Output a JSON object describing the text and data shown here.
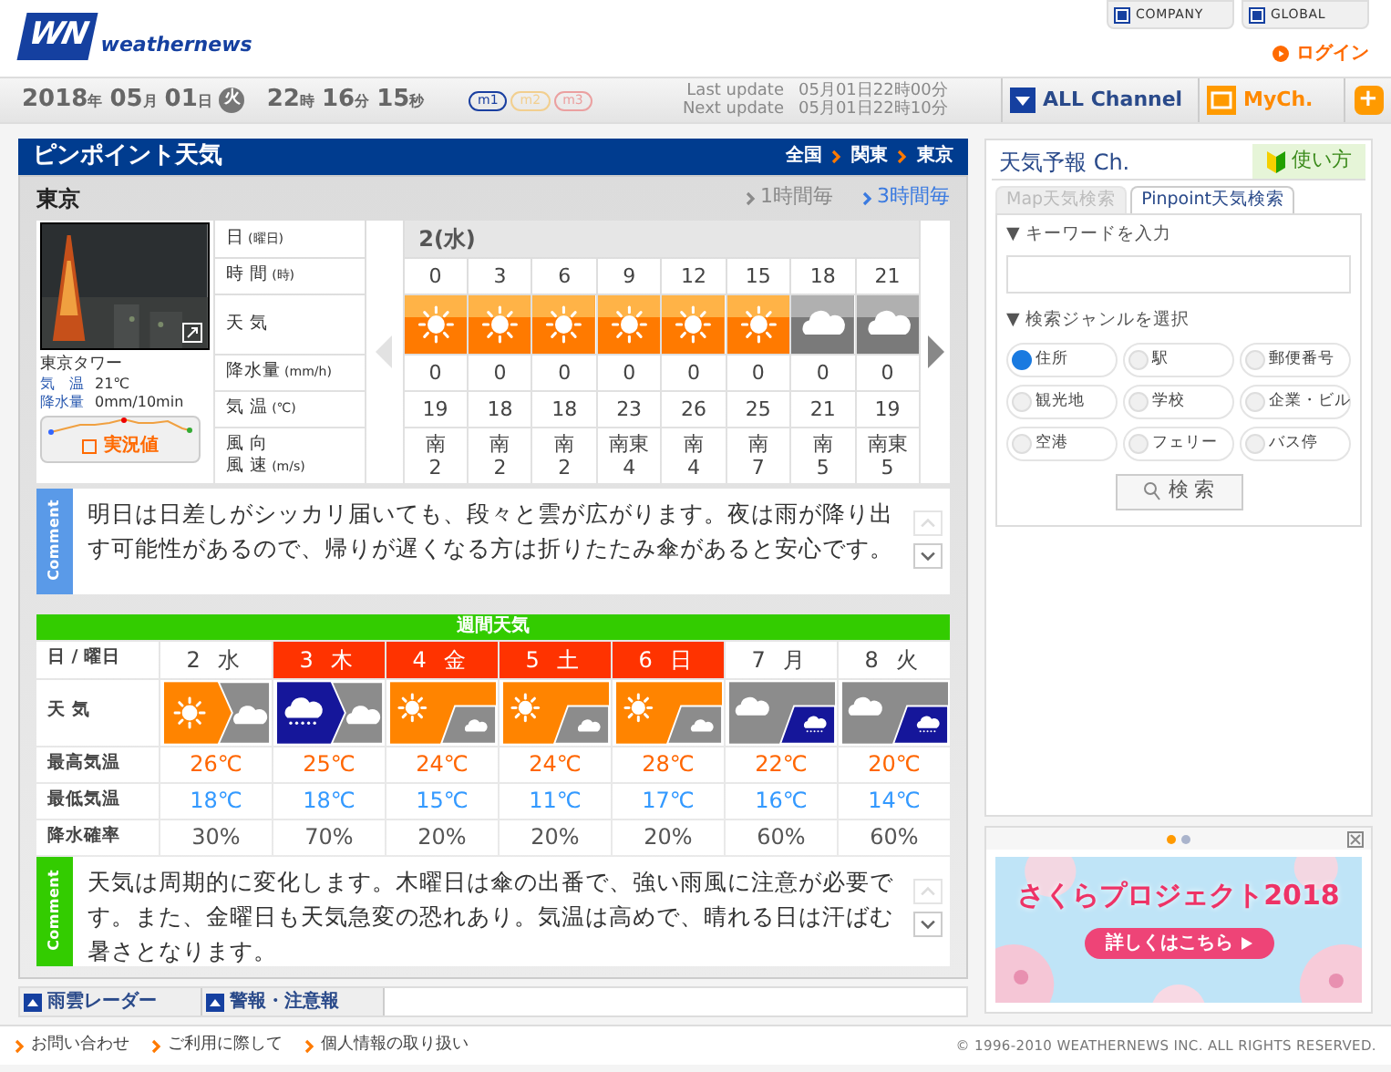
{
  "header": {
    "logo_mark": "WN",
    "logo_text": "weathernews",
    "links": [
      "COMPANY",
      "GLOBAL"
    ],
    "login": "ログイン"
  },
  "clock": {
    "date_parts": [
      {
        "value": "2018",
        "unit": "年"
      },
      {
        "value": "05",
        "unit": "月"
      },
      {
        "value": "01",
        "unit": "日"
      }
    ],
    "weekday": "火",
    "time_parts": [
      {
        "value": "22",
        "unit": "時"
      },
      {
        "value": "16",
        "unit": "分"
      },
      {
        "value": "15",
        "unit": "秒"
      }
    ]
  },
  "modes": [
    {
      "label": "m1",
      "color": "#1a3fa0"
    },
    {
      "label": "m2",
      "color": "#f2cf8f"
    },
    {
      "label": "m3",
      "color": "#eba0a0"
    }
  ],
  "updates": [
    {
      "label": "Last update",
      "value": "05月01日22時00分"
    },
    {
      "label": "Next update",
      "value": "05月01日22時10分"
    }
  ],
  "channels": [
    {
      "label": "ALL Channel",
      "kind": "all"
    },
    {
      "label": "MyCh.",
      "kind": "my"
    }
  ],
  "add_button": "+",
  "pinpoint": {
    "title": "ピンポイント天気",
    "breadcrumb": [
      "全国",
      "関東",
      "東京"
    ],
    "location": "東京",
    "intervals": [
      {
        "label": "1時間毎",
        "selected": false
      },
      {
        "label": "3時間毎",
        "selected": true
      }
    ],
    "camera": {
      "caption": "東京タワー",
      "readings": [
        {
          "label": "気　温",
          "value": "21℃"
        },
        {
          "label": "降水量",
          "value": "0mm/10min"
        }
      ],
      "button": "実況値"
    },
    "row_labels": [
      {
        "lines": [
          "日"
        ],
        "sub": "(曜日)"
      },
      {
        "lines": [
          "時 間"
        ],
        "sub": "(時)"
      },
      {
        "lines": [
          "天 気"
        ]
      },
      {
        "lines": [
          "降水量"
        ],
        "sub": "(mm/h)"
      },
      {
        "lines": [
          "気 温"
        ],
        "sub": "(℃)"
      },
      {
        "lines": [
          "風 向",
          "風 速"
        ],
        "sub": "(m/s)"
      }
    ],
    "day": "2(水)",
    "hours": [
      {
        "hour": "0",
        "kind": "sunny",
        "precip": "0",
        "temp": "19",
        "wind_dir": "南",
        "wind_speed": "2"
      },
      {
        "hour": "3",
        "kind": "sunny",
        "precip": "0",
        "temp": "18",
        "wind_dir": "南",
        "wind_speed": "2"
      },
      {
        "hour": "6",
        "kind": "sunny",
        "precip": "0",
        "temp": "18",
        "wind_dir": "南",
        "wind_speed": "2"
      },
      {
        "hour": "9",
        "kind": "sunny",
        "precip": "0",
        "temp": "23",
        "wind_dir": "南東",
        "wind_speed": "4"
      },
      {
        "hour": "12",
        "kind": "sunny",
        "precip": "0",
        "temp": "26",
        "wind_dir": "南",
        "wind_speed": "4"
      },
      {
        "hour": "15",
        "kind": "sunny",
        "precip": "0",
        "temp": "25",
        "wind_dir": "南",
        "wind_speed": "7"
      },
      {
        "hour": "18",
        "kind": "cloudy",
        "precip": "0",
        "temp": "21",
        "wind_dir": "南",
        "wind_speed": "5"
      },
      {
        "hour": "21",
        "kind": "cloudy",
        "precip": "0",
        "temp": "19",
        "wind_dir": "南東",
        "wind_speed": "5"
      }
    ],
    "comment": {
      "label": "Comment",
      "text": "明日は日差しがシッカリ届いても、段々と雲が広がります。夜は雨が降り出す可能性があるので、帰りが遅くなる方は折りたたみ傘があると安心です。"
    }
  },
  "weekly": {
    "title": "週間天気",
    "row_labels": [
      "日 / 曜日",
      "天 気",
      "最高気温",
      "最低気温",
      "降水確率"
    ],
    "days": [
      {
        "date": "2",
        "weekday": "水",
        "highlighted": false,
        "kind": "sunny_arrow_cloudy",
        "high": "26℃",
        "low": "18℃",
        "precip": "30%"
      },
      {
        "date": "3",
        "weekday": "木",
        "highlighted": true,
        "kind": "rain_arrow_cloudy",
        "high": "25℃",
        "low": "18℃",
        "precip": "70%"
      },
      {
        "date": "4",
        "weekday": "金",
        "highlighted": true,
        "kind": "sunny_split_cloudy",
        "high": "24℃",
        "low": "15℃",
        "precip": "20%"
      },
      {
        "date": "5",
        "weekday": "土",
        "highlighted": true,
        "kind": "sunny_split_cloudy",
        "high": "24℃",
        "low": "11℃",
        "precip": "20%"
      },
      {
        "date": "6",
        "weekday": "日",
        "highlighted": true,
        "kind": "sunny_split_cloudy",
        "high": "28℃",
        "low": "17℃",
        "precip": "20%"
      },
      {
        "date": "7",
        "weekday": "月",
        "highlighted": false,
        "kind": "cloudy_split_rain",
        "high": "22℃",
        "low": "16℃",
        "precip": "60%"
      },
      {
        "date": "8",
        "weekday": "火",
        "highlighted": false,
        "kind": "cloudy_split_rain",
        "high": "20℃",
        "low": "14℃",
        "precip": "60%"
      }
    ],
    "comment": {
      "label": "Comment",
      "text": "天気は周期的に変化します。木曜日は傘の出番で、強い雨風に注意が必要です。また、金曜日も天気急変の恐れあり。気温は高めで、晴れる日は汗ばむ暑さとなります。"
    }
  },
  "bottom_tabs": [
    "雨雲レーダー",
    "警報・注意報"
  ],
  "side": {
    "title": "天気予報 Ch.",
    "help": "使い方",
    "tabs": [
      {
        "label": "Map天気検索",
        "selected": false
      },
      {
        "label": "Pinpoint天気検索",
        "selected": true
      }
    ],
    "keyword_label": "▼ キーワードを入力",
    "genre_label": "▼ 検索ジャンルを選択",
    "genres": [
      {
        "label": "住所",
        "selected": true
      },
      {
        "label": "駅",
        "selected": false
      },
      {
        "label": "郵便番号",
        "selected": false
      },
      {
        "label": "観光地",
        "selected": false
      },
      {
        "label": "学校",
        "selected": false
      },
      {
        "label": "企業・ビル",
        "selected": false
      },
      {
        "label": "空港",
        "selected": false
      },
      {
        "label": "フェリー",
        "selected": false
      },
      {
        "label": "バス停",
        "selected": false
      }
    ],
    "search_button": "検 索"
  },
  "carousel": {
    "dots": [
      {
        "selected": true
      },
      {
        "selected": false
      }
    ]
  },
  "banner": {
    "title": "さくらプロジェクト2018",
    "button": "詳しくはこちら"
  },
  "footer": {
    "links": [
      "お問い合わせ",
      "ご利用に際して",
      "個人情報の取り扱い"
    ],
    "copyright": "© 1996-2010 WEATHERNEWS INC. ALL RIGHTS RESERVED."
  }
}
